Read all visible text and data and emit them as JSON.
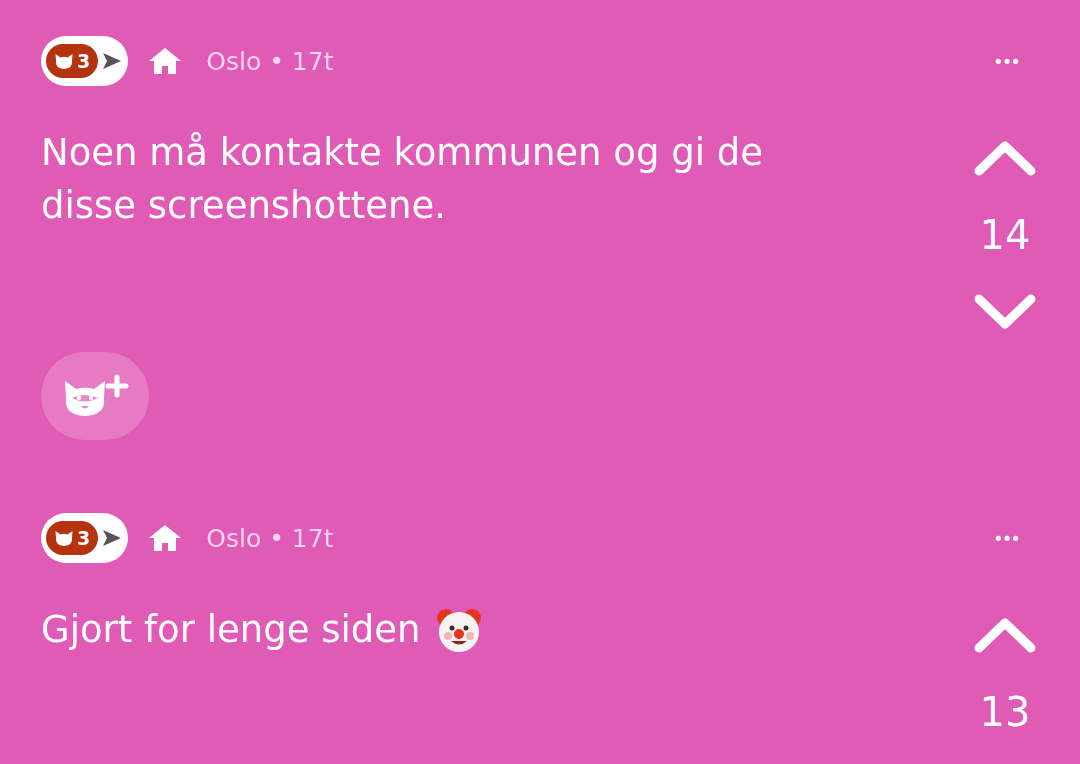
{
  "posts": [
    {
      "badge_count": "3",
      "meta": "Oslo • 17t",
      "more": "•••",
      "text": "Noen må kontakte kommunen og gi de disse screenshottene.",
      "kind": "plain",
      "votes": "14",
      "show_downvote": true,
      "reaction_button": true
    },
    {
      "badge_count": "3",
      "meta": "Oslo • 17t",
      "more": "•••",
      "text": "Gjort for lenge siden",
      "kind": "clown_emoji",
      "votes": "13",
      "show_downvote": false,
      "reaction_button": false
    }
  ]
}
